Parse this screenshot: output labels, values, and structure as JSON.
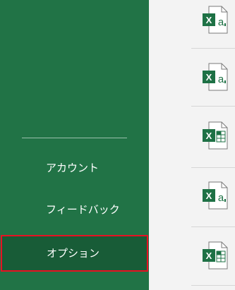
{
  "nav": {
    "items": [
      {
        "label": "アカウント"
      },
      {
        "label": "フィードバック"
      },
      {
        "label": "オプション",
        "selected": true
      }
    ],
    "background_color": "#217346",
    "selected_color": "#185c37",
    "highlight_border_color": "#e81123"
  },
  "recent_files": [
    {
      "icon": "excel-template-icon"
    },
    {
      "icon": "excel-template-icon"
    },
    {
      "icon": "excel-workbook-icon"
    },
    {
      "icon": "excel-template-icon"
    },
    {
      "icon": "excel-workbook-icon"
    }
  ],
  "colors": {
    "excel_green": "#1e7145",
    "file_list_background": "#f3f3f3"
  }
}
